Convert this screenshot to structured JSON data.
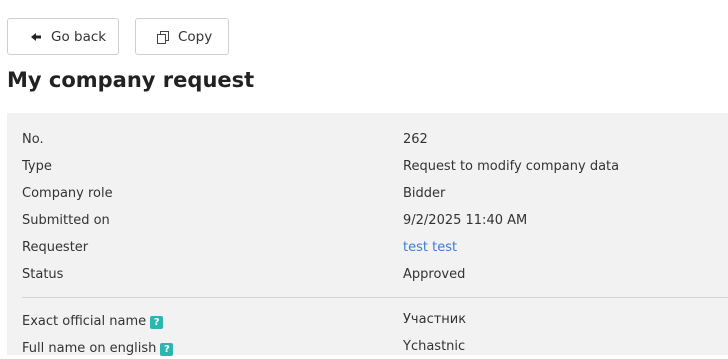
{
  "toolbar": {
    "back_label": "Go back",
    "copy_label": "Copy"
  },
  "page": {
    "title": "My company request"
  },
  "details": [
    {
      "label": "No.",
      "value": "262"
    },
    {
      "label": "Type",
      "value": "Request to modify company data"
    },
    {
      "label": "Company role",
      "value": "Bidder"
    },
    {
      "label": "Submitted on",
      "value": "9/2/2025 11:40 AM"
    },
    {
      "label": "Requester",
      "value": "test test"
    },
    {
      "label": "Status",
      "value": "Approved"
    }
  ],
  "company_fields": [
    {
      "label": "Exact official name",
      "value": "Участник",
      "help": "?"
    },
    {
      "label": "Full name on english",
      "value": "Ychastnic",
      "help": "?"
    }
  ],
  "colors": {
    "link": "#3b7dd8",
    "help_badge": "#2bb7b0",
    "panel_bg": "#f2f2f2"
  }
}
